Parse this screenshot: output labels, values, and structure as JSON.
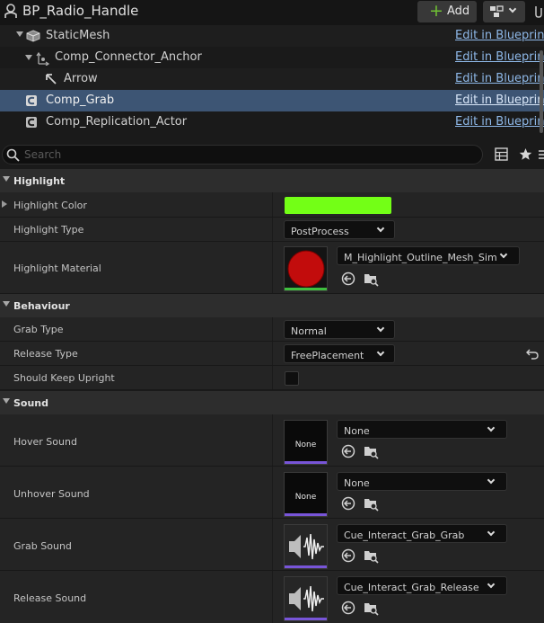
{
  "header": {
    "title": "BP_Radio_Handle",
    "add_label": "Add"
  },
  "tree": {
    "edit_label": "Edit in Blueprint",
    "items": [
      {
        "label": "StaticMesh",
        "icon": "static-mesh-icon"
      },
      {
        "label": "Comp_Connector_Anchor",
        "icon": "anchor-icon"
      },
      {
        "label": "Arrow",
        "icon": "arrow-icon"
      },
      {
        "label": "Comp_Grab",
        "icon": "component-icon",
        "selected": true
      },
      {
        "label": "Comp_Replication_Actor",
        "icon": "component-icon"
      }
    ]
  },
  "search": {
    "placeholder": "Search"
  },
  "sections": {
    "highlight": "Highlight",
    "behaviour": "Behaviour",
    "sound": "Sound"
  },
  "props": {
    "highlight_color": {
      "label": "Highlight Color",
      "color": "#73ff16"
    },
    "highlight_type": {
      "label": "Highlight Type",
      "value": "PostProcess"
    },
    "highlight_material": {
      "label": "Highlight Material",
      "value": "M_Highlight_Outline_Mesh_Simple"
    },
    "grab_type": {
      "label": "Grab Type",
      "value": "Normal"
    },
    "release_type": {
      "label": "Release Type",
      "value": "FreePlacement"
    },
    "keep_upright": {
      "label": "Should Keep Upright",
      "checked": false
    },
    "hover_sound": {
      "label": "Hover Sound",
      "value": "None",
      "thumb_text": "None"
    },
    "unhover_sound": {
      "label": "Unhover Sound",
      "value": "None",
      "thumb_text": "None"
    },
    "grab_sound": {
      "label": "Grab Sound",
      "value": "Cue_Interact_Grab_Grab"
    },
    "release_sound": {
      "label": "Release Sound",
      "value": "Cue_Interact_Grab_Release"
    }
  },
  "colors": {
    "accent_link": "#8eb8e8",
    "selection": "#3d5574",
    "sound_bar": "#7855d8",
    "add_green": "#6fbf34"
  }
}
